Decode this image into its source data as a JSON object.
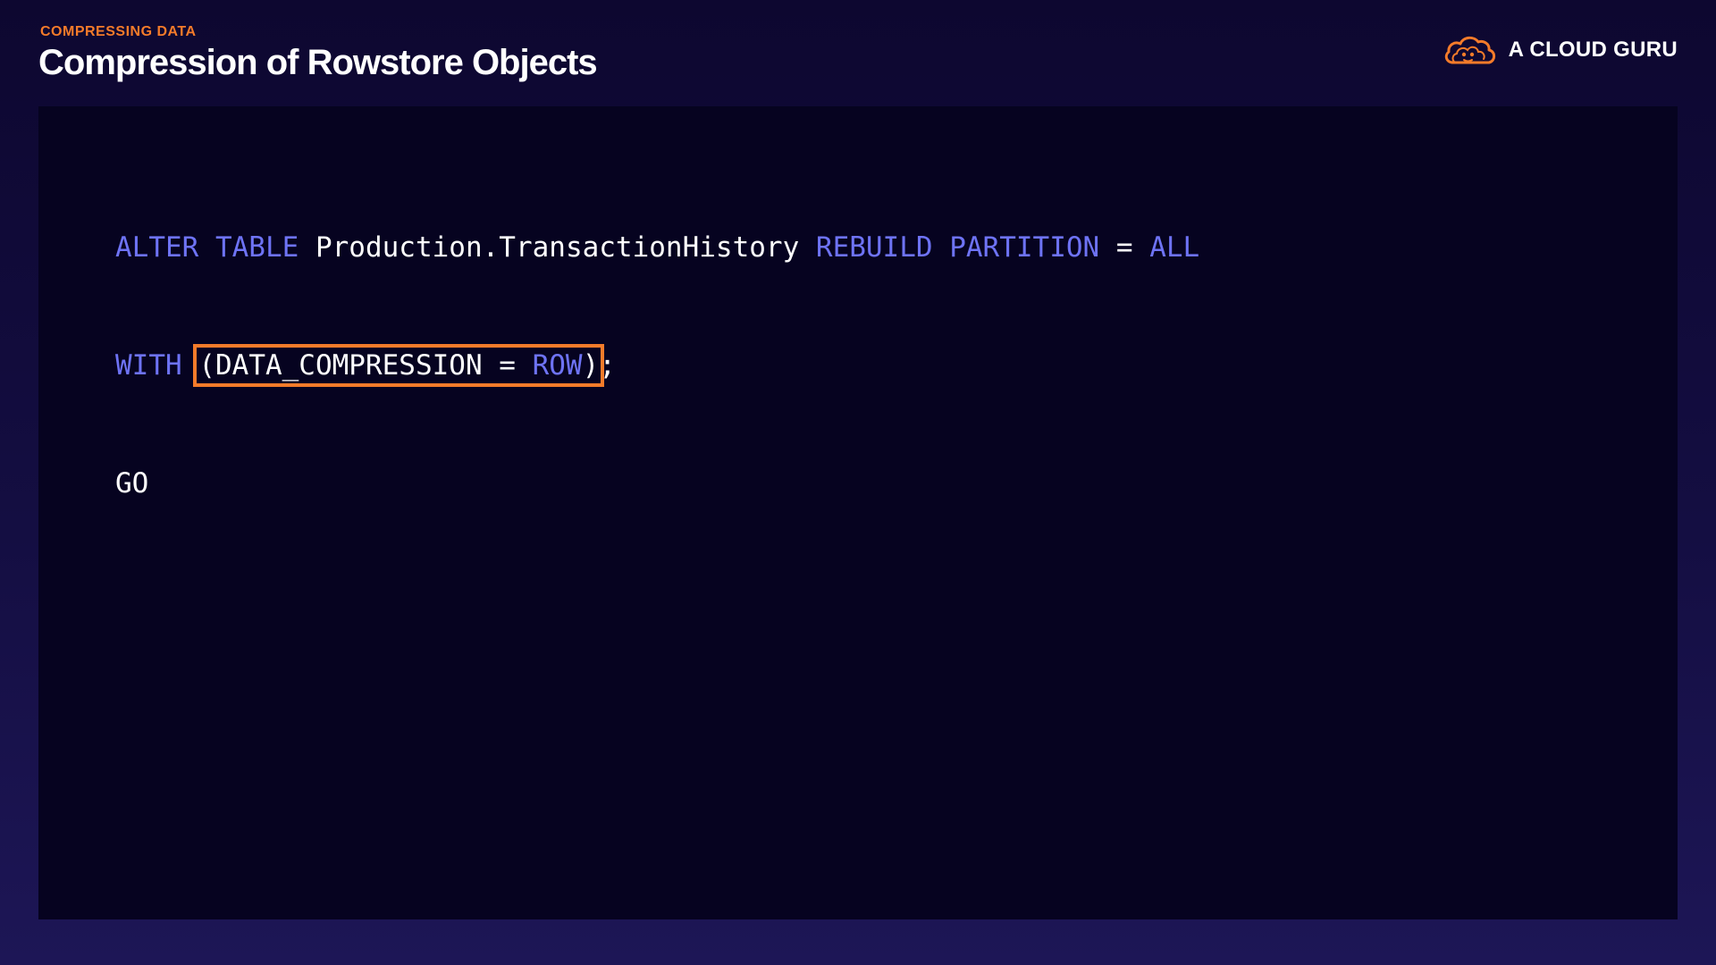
{
  "header": {
    "eyebrow": "COMPRESSING DATA",
    "title": "Compression of Rowstore Objects"
  },
  "brand": {
    "name": "A CLOUD GURU",
    "logo_icon": "cloud-logo-icon"
  },
  "code": {
    "line1": {
      "alter_table": "ALTER TABLE",
      "table_name": "Production.TransactionHistory",
      "rebuild_partition": "REBUILD PARTITION",
      "equals": "=",
      "all": "ALL"
    },
    "line2": {
      "with": "WITH",
      "open_paren_option": "(DATA_COMPRESSION =",
      "row": "ROW",
      "close_paren": ")",
      "semicolon": ";"
    },
    "line3": {
      "go": "GO"
    }
  },
  "colors": {
    "accent": "#f47b2a",
    "keyword": "#6e73f5",
    "text": "#ffffff",
    "code_background": "#060320"
  }
}
